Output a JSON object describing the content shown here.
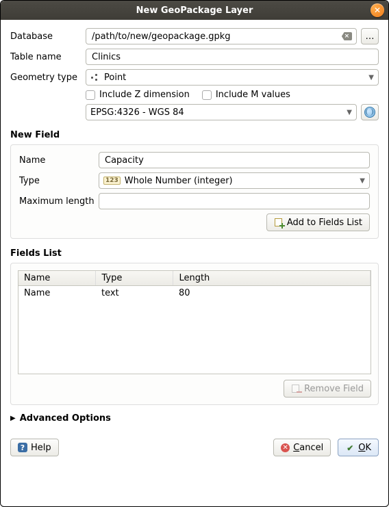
{
  "window": {
    "title": "New GeoPackage Layer"
  },
  "form": {
    "database_label": "Database",
    "database_value": "/path/to/new/geopackage.gpkg",
    "browse_label": "…",
    "table_label": "Table name",
    "table_value": "Clinics",
    "geometry_label": "Geometry type",
    "geometry_value": "Point",
    "include_z_label": "Include Z dimension",
    "include_m_label": "Include M values",
    "include_z_checked": false,
    "include_m_checked": false,
    "crs_value": "EPSG:4326 - WGS 84"
  },
  "new_field": {
    "section_label": "New Field",
    "name_label": "Name",
    "name_value": "Capacity",
    "type_label": "Type",
    "type_value": "Whole Number (integer)",
    "type_icon_text": "123",
    "maxlen_label": "Maximum length",
    "maxlen_value": "",
    "add_button": "Add to Fields List"
  },
  "fields_list": {
    "section_label": "Fields List",
    "headers": {
      "name": "Name",
      "type": "Type",
      "length": "Length"
    },
    "rows": [
      {
        "name": "Name",
        "type": "text",
        "length": "80"
      }
    ],
    "remove_button": "Remove Field",
    "remove_enabled": false
  },
  "advanced": {
    "label": "Advanced Options",
    "expanded": false
  },
  "footer": {
    "help": "Help",
    "cancel": "Cancel",
    "ok": "OK"
  }
}
